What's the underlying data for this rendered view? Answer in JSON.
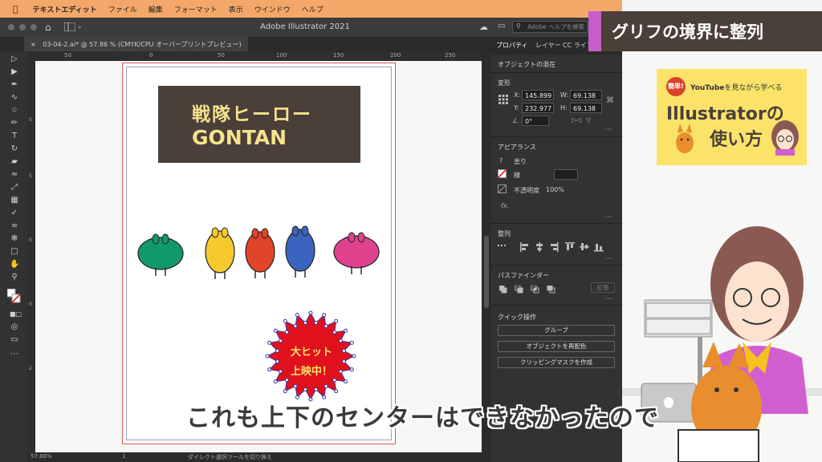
{
  "menubar": {
    "app_name": "テキストエディット",
    "items": [
      "ファイル",
      "編集",
      "フォーマット",
      "表示",
      "ウインドウ",
      "ヘルプ"
    ]
  },
  "app": {
    "title": "Adobe Illustrator 2021",
    "help_search_placeholder": "Adobe ヘルプを検索"
  },
  "document_tab": {
    "label": "03-04-2.ai* @ 57.86 % (CMYK/CPU オーバープリントプレビュー)"
  },
  "ruler": {
    "ticks": [
      "50",
      "0",
      "50",
      "100",
      "150",
      "200",
      "250"
    ]
  },
  "vruler": {
    "ticks": [
      "0",
      "5",
      "0",
      "1",
      "0",
      "0",
      "1",
      "5",
      "0",
      "2",
      "0",
      "0",
      "2",
      "5",
      "0"
    ]
  },
  "artwork": {
    "banner_line1": "戦隊ヒーロー",
    "banner_line2": "GONTAN",
    "badge_line1": "大ヒット",
    "badge_line2": "上映中！",
    "banner_color": "#4b3f3a",
    "banner_text_color": "#f4e38c",
    "creature_colors": [
      "#12996a",
      "#f7c92f",
      "#e2442a",
      "#3b63c0",
      "#e0428e"
    ],
    "badge_color": "#e0111c"
  },
  "panel": {
    "tabs": [
      "プロパティ",
      "レイヤー",
      "CC ライブ"
    ],
    "object_type": "オブジェクトの混在",
    "transform": {
      "title": "変形",
      "x_label": "X:",
      "x": "145.899",
      "y_label": "Y:",
      "y": "232.977",
      "w_label": "W:",
      "w": "69.138",
      "h_label": "H:",
      "h": "69.138",
      "angle": "0°"
    },
    "appearance": {
      "title": "アピアランス",
      "fill_label": "塗り",
      "stroke_label": "線",
      "opacity_label": "不透明度",
      "opacity": "100%",
      "fx": "fx."
    },
    "align": {
      "title": "整列"
    },
    "pathfinder": {
      "title": "パスファインダー",
      "expand_label": "拡張"
    },
    "quick_actions": {
      "title": "クイック操作",
      "buttons": [
        "グループ",
        "オブジェクトを再配色",
        "クリッピングマスクを作成"
      ]
    }
  },
  "statusbar": {
    "zoom": "57.86%",
    "artboard": "1",
    "tool": "ダイレクト選択ツールを切り換え"
  },
  "overlay": {
    "title": "グリフの境界に整列",
    "logo_badge": "簡単!",
    "logo_tagline_prefix": "YouTube",
    "logo_tagline_suffix": "を見ながら学べる",
    "logo_line1": "Illustratorの",
    "logo_line2": "使い方",
    "subtitle": "これも上下のセンターはできなかったので",
    "accent_color": "#c55ec8"
  }
}
